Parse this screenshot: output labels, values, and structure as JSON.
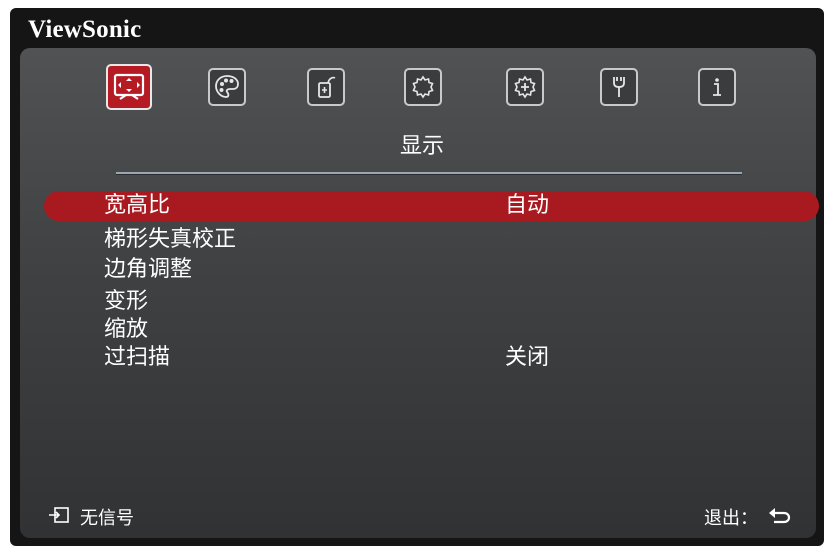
{
  "brand": "ViewSonic",
  "tabs": [
    {
      "icon": "display-icon",
      "active": true
    },
    {
      "icon": "palette-icon",
      "active": false
    },
    {
      "icon": "power-icon",
      "active": false
    },
    {
      "icon": "basic-settings-gear-icon",
      "active": false
    },
    {
      "icon": "advanced-settings-gear-icon",
      "active": false
    },
    {
      "icon": "wrench-icon",
      "active": false
    },
    {
      "icon": "info-icon",
      "active": false
    }
  ],
  "active_tab_title": "显示",
  "menu": {
    "items": [
      {
        "label": "宽高比",
        "value": "自动"
      },
      {
        "label": "梯形失真校正",
        "value": ""
      },
      {
        "label": "边角调整",
        "value": ""
      },
      {
        "label": "变形",
        "value": ""
      },
      {
        "label": "缩放",
        "value": ""
      },
      {
        "label": "过扫描",
        "value": "关闭"
      }
    ],
    "selected_index": 0
  },
  "footer": {
    "source_icon": "input-source-icon",
    "source_text": "无信号",
    "exit_text": "退出：",
    "exit_icon": "return-arrow-icon"
  },
  "colors": {
    "highlight": "#a91a20",
    "active_tab": "#b41b22"
  }
}
